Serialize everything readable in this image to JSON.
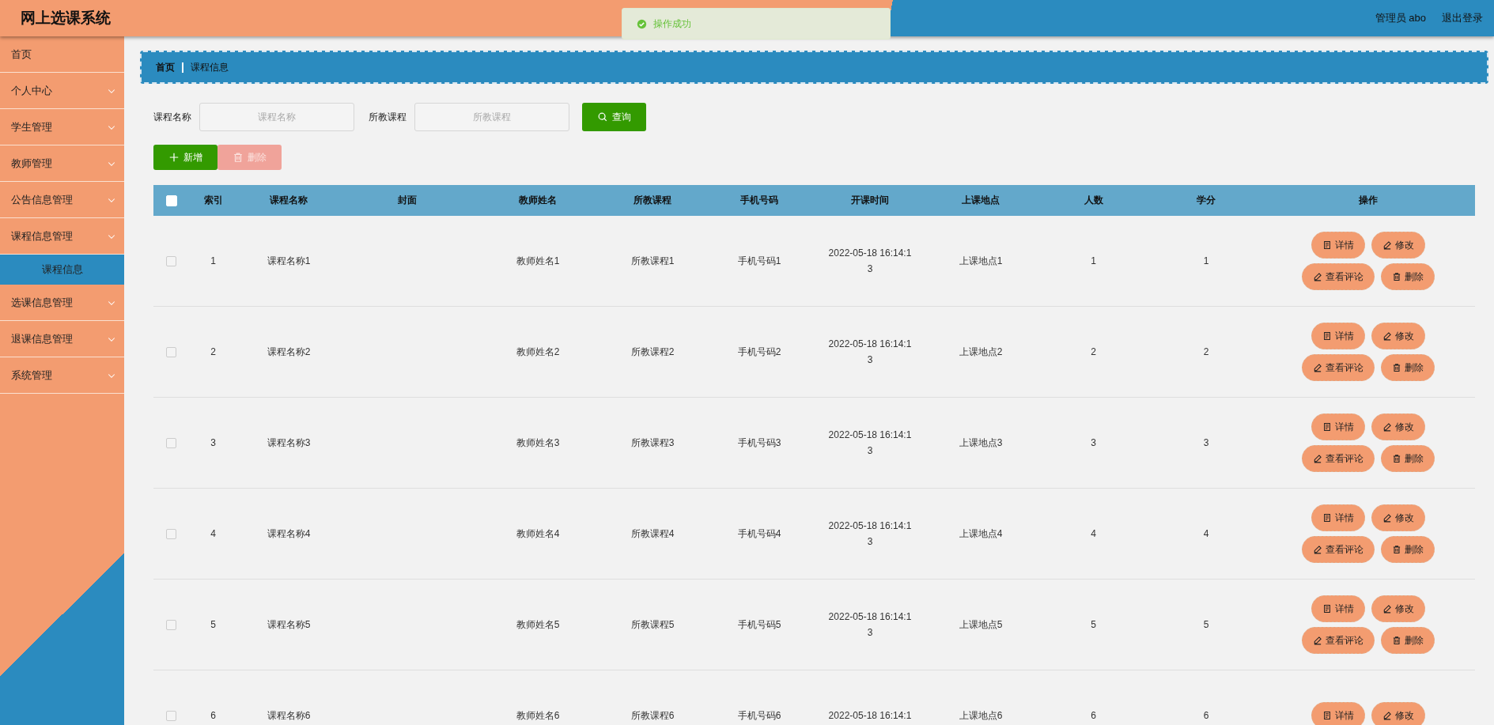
{
  "header": {
    "title": "网上选课系统",
    "toast": {
      "text": "操作成功",
      "kind": "success"
    },
    "user": "管理员 abo",
    "logout": "退出登录"
  },
  "sidebar": {
    "items": [
      {
        "label": "首页",
        "kind": "link"
      },
      {
        "label": "个人中心",
        "kind": "menu"
      },
      {
        "label": "学生管理",
        "kind": "menu"
      },
      {
        "label": "教师管理",
        "kind": "menu"
      },
      {
        "label": "公告信息管理",
        "kind": "menu"
      },
      {
        "label": "课程信息管理",
        "kind": "menu",
        "children": [
          {
            "label": "课程信息",
            "selected": true
          }
        ]
      },
      {
        "label": "选课信息管理",
        "kind": "menu"
      },
      {
        "label": "退课信息管理",
        "kind": "menu"
      },
      {
        "label": "系统管理",
        "kind": "menu"
      }
    ]
  },
  "breadcrumb": [
    "首页",
    "课程信息"
  ],
  "search": {
    "fields": [
      {
        "label": "课程名称",
        "placeholder": "课程名称"
      },
      {
        "label": "所教课程",
        "placeholder": "所教课程"
      }
    ],
    "button": "查询"
  },
  "toolbar": [
    {
      "label": "新增",
      "kind": "add",
      "disabled": false
    },
    {
      "label": "删除",
      "kind": "delete",
      "disabled": true
    }
  ],
  "table": {
    "header_checked": false,
    "columns": [
      "索引",
      "课程名称",
      "封面",
      "教师姓名",
      "所教课程",
      "手机号码",
      "开课时间",
      "上课地点",
      "人数",
      "学分",
      "操作"
    ],
    "rows": [
      {
        "checked": false,
        "cells": [
          "1",
          "课程名称1",
          "",
          "教师姓名1",
          "所教课程1",
          "手机号码1",
          "2022-05-18 16:14:13",
          "上课地点1",
          "1",
          "1"
        ],
        "actions": [
          {
            "label": "详情",
            "kind": "detail"
          },
          {
            "label": "修改",
            "kind": "edit"
          },
          {
            "label": "查看评论",
            "kind": "edit"
          },
          {
            "label": "删除",
            "kind": "delete"
          }
        ]
      },
      {
        "checked": false,
        "cells": [
          "2",
          "课程名称2",
          "",
          "教师姓名2",
          "所教课程2",
          "手机号码2",
          "2022-05-18 16:14:13",
          "上课地点2",
          "2",
          "2"
        ],
        "actions": [
          {
            "label": "详情",
            "kind": "detail"
          },
          {
            "label": "修改",
            "kind": "edit"
          },
          {
            "label": "查看评论",
            "kind": "edit"
          },
          {
            "label": "删除",
            "kind": "delete"
          }
        ]
      },
      {
        "checked": false,
        "cells": [
          "3",
          "课程名称3",
          "",
          "教师姓名3",
          "所教课程3",
          "手机号码3",
          "2022-05-18 16:14:13",
          "上课地点3",
          "3",
          "3"
        ],
        "actions": [
          {
            "label": "详情",
            "kind": "detail"
          },
          {
            "label": "修改",
            "kind": "edit"
          },
          {
            "label": "查看评论",
            "kind": "edit"
          },
          {
            "label": "删除",
            "kind": "delete"
          }
        ]
      },
      {
        "checked": false,
        "cells": [
          "4",
          "课程名称4",
          "",
          "教师姓名4",
          "所教课程4",
          "手机号码4",
          "2022-05-18 16:14:13",
          "上课地点4",
          "4",
          "4"
        ],
        "actions": [
          {
            "label": "详情",
            "kind": "detail"
          },
          {
            "label": "修改",
            "kind": "edit"
          },
          {
            "label": "查看评论",
            "kind": "edit"
          },
          {
            "label": "删除",
            "kind": "delete"
          }
        ]
      },
      {
        "checked": false,
        "cells": [
          "5",
          "课程名称5",
          "",
          "教师姓名5",
          "所教课程5",
          "手机号码5",
          "2022-05-18 16:14:13",
          "上课地点5",
          "5",
          "5"
        ],
        "actions": [
          {
            "label": "详情",
            "kind": "detail"
          },
          {
            "label": "修改",
            "kind": "edit"
          },
          {
            "label": "查看评论",
            "kind": "edit"
          },
          {
            "label": "删除",
            "kind": "delete"
          }
        ]
      },
      {
        "checked": false,
        "cells": [
          "6",
          "课程名称6",
          "",
          "教师姓名6",
          "所教课程6",
          "手机号码6",
          "2022-05-18 16:14:1",
          "上课地点6",
          "6",
          "6"
        ],
        "actions": [
          {
            "label": "详情",
            "kind": "detail"
          },
          {
            "label": "修改",
            "kind": "edit"
          }
        ]
      }
    ]
  }
}
